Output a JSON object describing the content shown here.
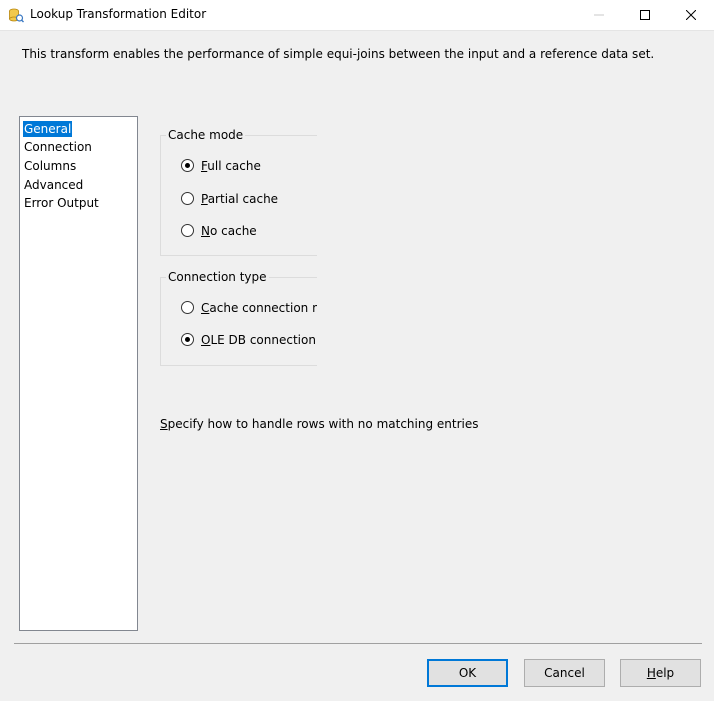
{
  "window": {
    "title": "Lookup Transformation Editor",
    "icon": "lookup-transform-icon"
  },
  "description": "This transform enables the performance of simple equi-joins between the input and a reference data set.",
  "nav": {
    "items": [
      {
        "label": "General",
        "selected": true
      },
      {
        "label": "Connection",
        "selected": false
      },
      {
        "label": "Columns",
        "selected": false
      },
      {
        "label": "Advanced",
        "selected": false
      },
      {
        "label": "Error Output",
        "selected": false
      }
    ]
  },
  "cache_mode": {
    "title": "Cache mode",
    "options": [
      {
        "accel": "F",
        "rest": "ull cache",
        "checked": true
      },
      {
        "accel": "P",
        "rest": "artial cache",
        "checked": false
      },
      {
        "accel": "N",
        "rest": "o cache",
        "checked": false
      }
    ]
  },
  "connection_type": {
    "title": "Connection type",
    "options": [
      {
        "accel": "C",
        "rest": "ache connection mar",
        "checked": false
      },
      {
        "accel": "O",
        "rest": "LE DB connection ma",
        "checked": true
      }
    ]
  },
  "handle_rows": {
    "accel": "S",
    "rest": "pecify how to handle rows with no matching entries"
  },
  "buttons": {
    "ok": "OK",
    "cancel": "Cancel",
    "help_accel": "H",
    "help_rest": "elp"
  },
  "colors": {
    "selection": "#0078d7",
    "background": "#f0f0f0"
  }
}
